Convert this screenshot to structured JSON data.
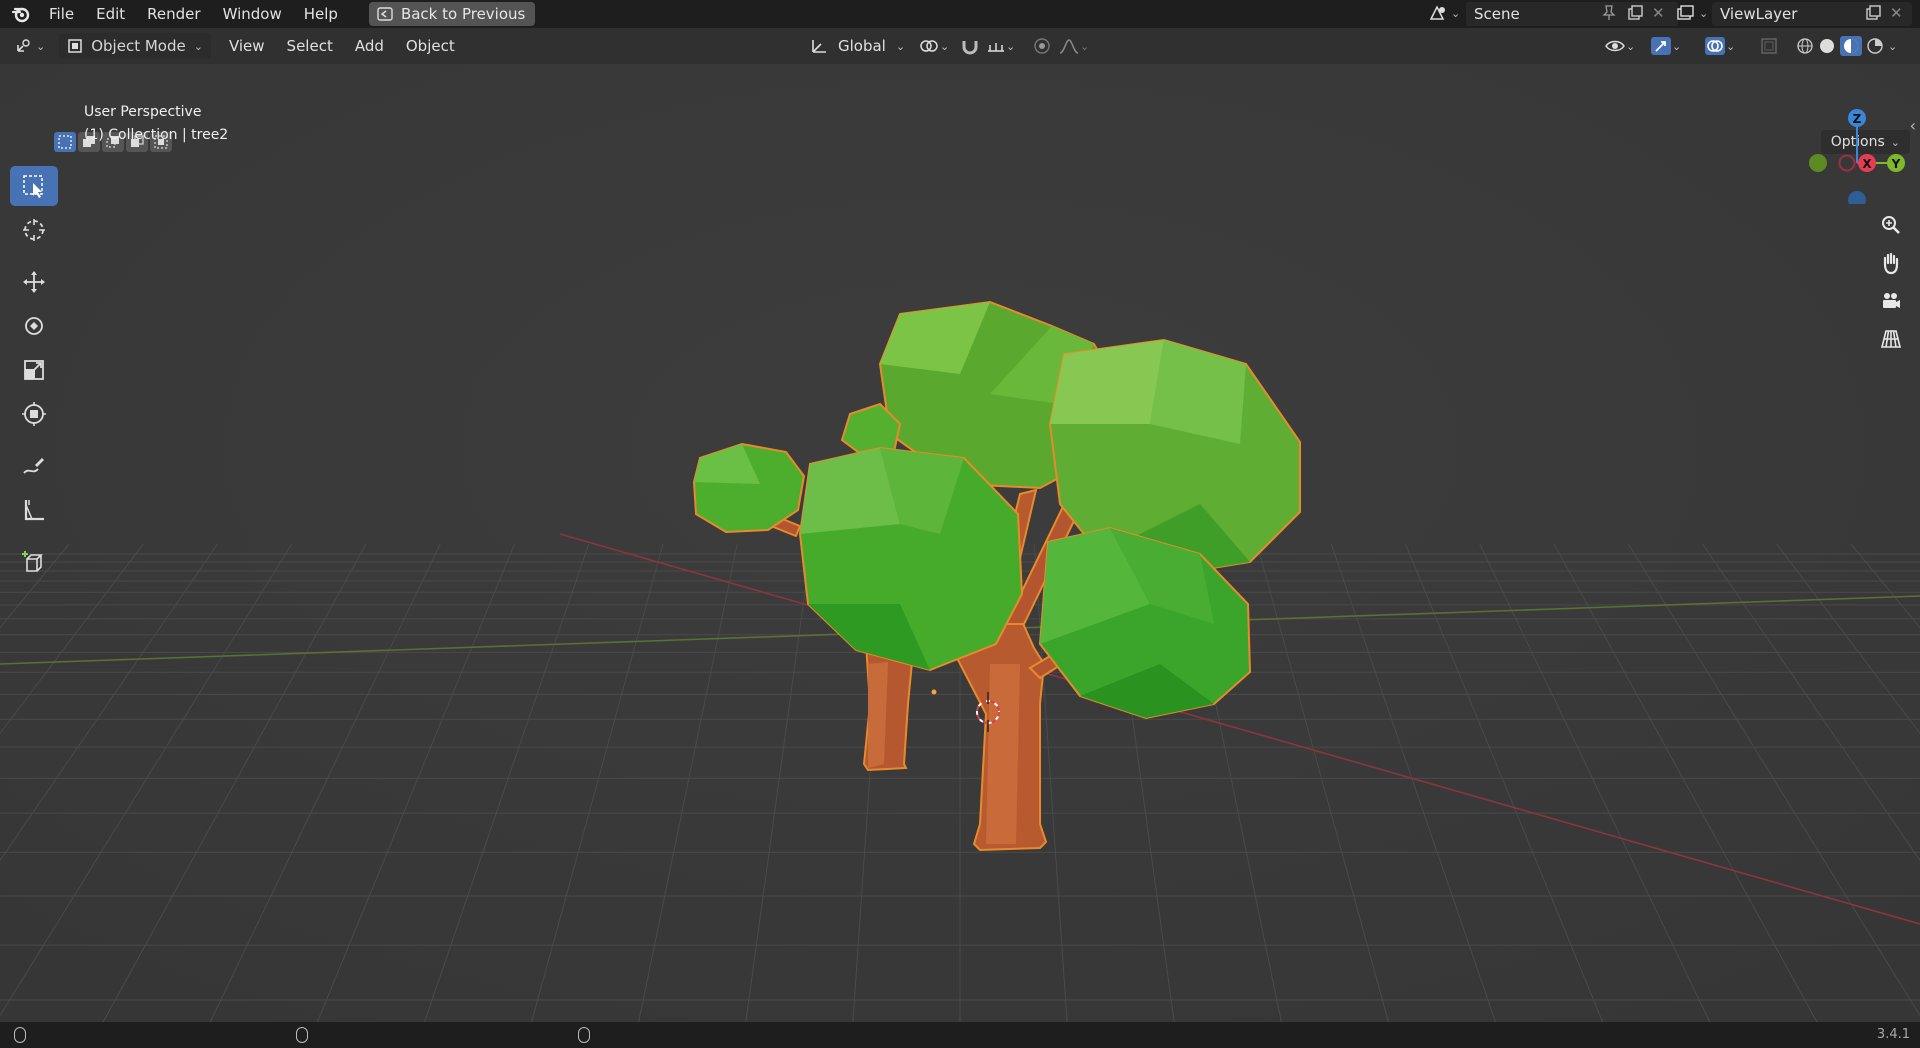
{
  "app": {
    "logo_icon": "blender-logo-icon"
  },
  "menubar": {
    "items": [
      "File",
      "Edit",
      "Render",
      "Window",
      "Help"
    ],
    "back_button": "Back to Previous"
  },
  "scene": {
    "name": "Scene",
    "view_layer": "ViewLayer"
  },
  "header": {
    "mode": "Object Mode",
    "menus": [
      "View",
      "Select",
      "Add",
      "Object"
    ],
    "transform_orientation": "Global"
  },
  "viewport": {
    "perspective_label": "User Perspective",
    "object_label": "(1) Collection | tree2",
    "options_label": "Options"
  },
  "gizmo": {
    "z_label": "Z",
    "x_label": "X",
    "y_label": "Y"
  },
  "status": {
    "version": "3.4.1"
  },
  "colors": {
    "accent": "#4772b3",
    "x_axis": "#e83c54",
    "y_axis": "#7fb92b",
    "z_axis": "#3a86d9",
    "selection_outline": "#f0a040"
  }
}
